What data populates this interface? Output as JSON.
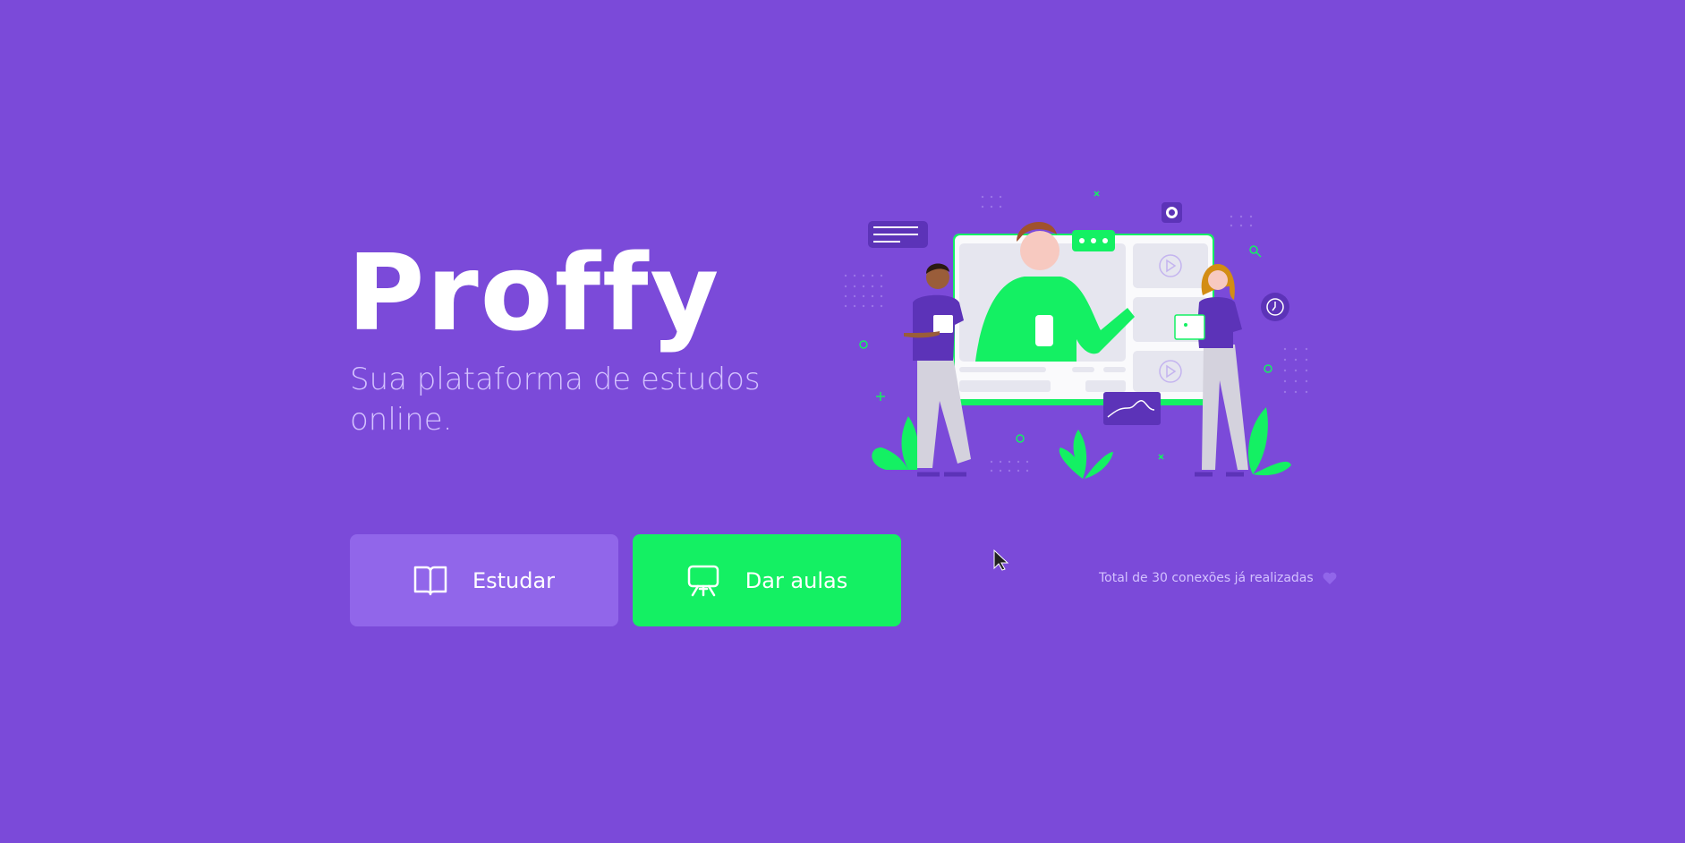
{
  "logo": {
    "text": "Proffy"
  },
  "tagline": "Sua plataforma de estudos online.",
  "buttons": {
    "study": {
      "label": "Estudar",
      "icon": "book-open-icon"
    },
    "give_classes": {
      "label": "Dar aulas",
      "icon": "presentation-board-icon"
    }
  },
  "counter": {
    "text": "Total de 30 conexões já realizadas",
    "icon": "heart-icon"
  },
  "colors": {
    "background": "#7b4ad9",
    "study_button": "#9166ea",
    "give_classes_button": "#14f063",
    "tagline": "#d4c2ff"
  }
}
